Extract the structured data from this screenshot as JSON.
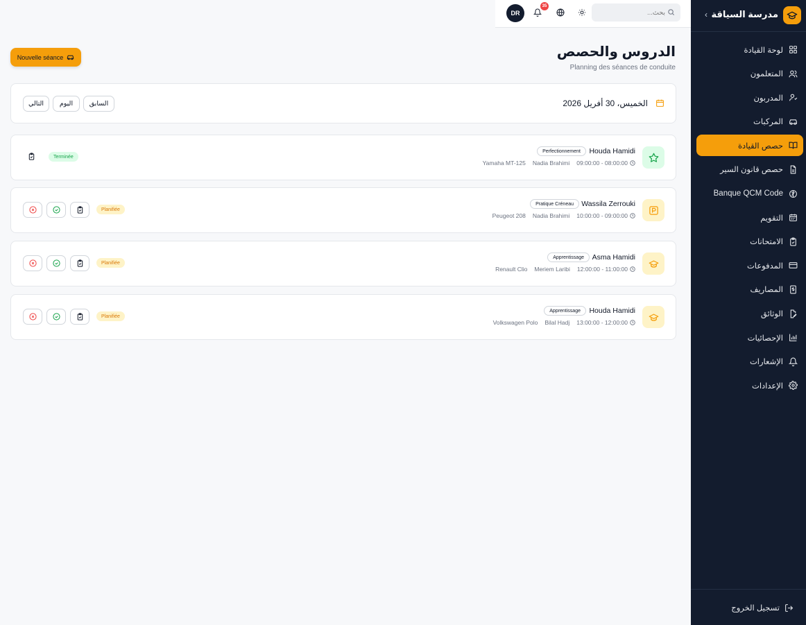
{
  "brand": {
    "title": "مدرسة السياقة",
    "collapse_icon": "chevron-left-icon"
  },
  "sidebar": {
    "items": [
      {
        "label": "لوحة القيادة",
        "icon": "dashboard-icon",
        "active": false
      },
      {
        "label": "المتعلمون",
        "icon": "users-icon",
        "active": false
      },
      {
        "label": "المدربون",
        "icon": "instructor-icon",
        "active": false
      },
      {
        "label": "المركبات",
        "icon": "car-icon",
        "active": false
      },
      {
        "label": "حصص القيادة",
        "icon": "book-open-icon",
        "active": true
      },
      {
        "label": "حصص قانون السير",
        "icon": "file-text-icon",
        "active": false
      },
      {
        "label": "Banque QCM Code",
        "icon": "brain-icon",
        "active": false
      },
      {
        "label": "التقويم",
        "icon": "calendar-icon",
        "active": false
      },
      {
        "label": "الامتحانات",
        "icon": "clipboard-check-icon",
        "active": false
      },
      {
        "label": "المدفوعات",
        "icon": "credit-card-icon",
        "active": false
      },
      {
        "label": "المصاريف",
        "icon": "receipt-icon",
        "active": false
      },
      {
        "label": "الوثائق",
        "icon": "document-edit-icon",
        "active": false
      },
      {
        "label": "الإحصائيات",
        "icon": "bar-chart-icon",
        "active": false
      },
      {
        "label": "الإشعارات",
        "icon": "bell-icon",
        "active": false
      },
      {
        "label": "الإعدادات",
        "icon": "gear-icon",
        "active": false
      }
    ],
    "logout_label": "تسجيل الخروج"
  },
  "topbar": {
    "search_placeholder": "بحث...",
    "notification_count": "35",
    "avatar_initials": "DR"
  },
  "header": {
    "title": "الدروس والحصص",
    "subtitle": "Planning des séances de conduite",
    "new_session_label": "Nouvelle séance"
  },
  "date_nav": {
    "date_label": "الخميس، 30 أفريل 2026",
    "prev_label": "السابق",
    "today_label": "اليوم",
    "next_label": "التالي"
  },
  "colors": {
    "accent": "#f59e0b",
    "sidebar_bg": "#131c2e",
    "done": "#16a34a",
    "planned": "#d97706",
    "cancel": "#ef4444"
  },
  "lessons": [
    {
      "student": "Houda Hamidi",
      "type": "Perfectionnement",
      "time": "08:00:00 - 09:00:00",
      "instructor": "Nadia Brahimi",
      "vehicle": "Yamaha MT-125",
      "status": "Terminée",
      "icon": "star-icon"
    },
    {
      "student": "Wassila Zerrouki",
      "type": "Pratique Créneau",
      "time": "09:00:00 - 10:00:00",
      "instructor": "Nadia Brahimi",
      "vehicle": "Peugeot 208",
      "status": "Planifiée",
      "icon": "parking-icon"
    },
    {
      "student": "Asma Hamidi",
      "type": "Apprentissage",
      "time": "11:00:00 - 12:00:00",
      "instructor": "Meriem Laribi",
      "vehicle": "Renault Clio",
      "status": "Planifiée",
      "icon": "graduation-cap-icon"
    },
    {
      "student": "Houda Hamidi",
      "type": "Apprentissage",
      "time": "12:00:00 - 13:00:00",
      "instructor": "Bilal Hadj",
      "vehicle": "Volkswagen Polo",
      "status": "Planifiée",
      "icon": "graduation-cap-icon"
    }
  ]
}
